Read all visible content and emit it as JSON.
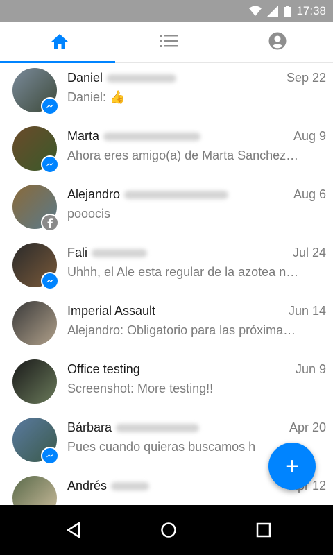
{
  "status_bar": {
    "time": "17:38",
    "icons": [
      "wifi-icon",
      "signal-icon",
      "battery-icon"
    ]
  },
  "tabs": [
    {
      "icon": "home-icon",
      "active": true
    },
    {
      "icon": "list-icon",
      "active": false
    },
    {
      "icon": "profile-icon",
      "active": false
    }
  ],
  "conversations": [
    {
      "first_name": "Daniel",
      "date": "Sep 22",
      "snippet": "Daniel: 👍",
      "badge": "messenger-icon",
      "avatar_colors": [
        "#7a8a9a",
        "#3d4a3a"
      ]
    },
    {
      "first_name": "Marta",
      "date": "Aug 9",
      "snippet": "Ahora eres amigo(a) de Marta Sanchez…",
      "badge": "messenger-icon",
      "avatar_colors": [
        "#6b4a2a",
        "#3a5a2a"
      ]
    },
    {
      "first_name": "Alejandro",
      "date": "Aug 6",
      "snippet": "pooocis",
      "badge": "facebook-icon",
      "avatar_colors": [
        "#8a6a3a",
        "#5a7a8a"
      ]
    },
    {
      "first_name": "Fali",
      "date": "Jul 24",
      "snippet": "Uhhh, el Ale esta regular de la azotea n…",
      "badge": "messenger-icon",
      "avatar_colors": [
        "#2a2a2a",
        "#7a5a3a"
      ]
    },
    {
      "first_name": "Imperial Assault",
      "date": "Jun 14",
      "snippet": "Alejandro: Obligatorio para las próxima…",
      "badge": "",
      "avatar_colors": [
        "#3a3a3a",
        "#b0a08a"
      ]
    },
    {
      "first_name": "Office testing",
      "date": "Jun 9",
      "snippet": "Screenshot: More testing!!",
      "badge": "",
      "avatar_colors": [
        "#1a1a1a",
        "#6a7a5a"
      ]
    },
    {
      "first_name": "Bárbara",
      "date": "Apr 20",
      "snippet": "Pues cuando quieras buscamos h",
      "badge": "messenger-icon",
      "avatar_colors": [
        "#5a7aa0",
        "#3a5a4a"
      ]
    },
    {
      "first_name": "Andrés",
      "date": "Apr 12",
      "snippet": "",
      "badge": "",
      "avatar_colors": [
        "#5a6a4a",
        "#d0c0a0"
      ]
    }
  ],
  "fab": {
    "label": "+"
  },
  "accent_color": "#0084ff"
}
